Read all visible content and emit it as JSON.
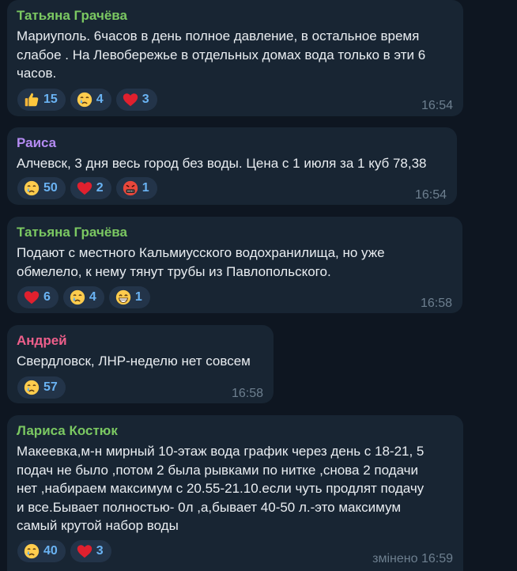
{
  "colors": {
    "background": "#0e1621",
    "bubble": "#182533",
    "reaction_chip": "#233449",
    "reaction_count": "#6ab3f3",
    "time": "#6d7f8f",
    "name_green": "#7bc862",
    "name_purple": "#b48bf2",
    "name_pink": "#ee5f8b"
  },
  "messages": [
    {
      "author": "Татьяна Грачёва",
      "author_color": "#7bc862",
      "lines": [
        "Мариуполь. 6часов в день полное давление, в остальное время",
        "слабое . На Левобережье в отдельных домах вода только в эти 6",
        "часов."
      ],
      "reactions": [
        {
          "icon": "thumbs-up-icon",
          "count": "15"
        },
        {
          "icon": "crying-face-icon",
          "count": "4"
        },
        {
          "icon": "red-heart-icon",
          "count": "3"
        }
      ],
      "time": "16:54"
    },
    {
      "author": "Раиса",
      "author_color": "#b48bf2",
      "lines": [
        "Алчевск, 3 дня весь город без воды. Цена с 1 июля за 1 куб 78,38"
      ],
      "reactions": [
        {
          "icon": "crying-face-icon",
          "count": "50"
        },
        {
          "icon": "red-heart-icon",
          "count": "2"
        },
        {
          "icon": "swearing-face-icon",
          "count": "1"
        }
      ],
      "time": "16:54"
    },
    {
      "author": "Татьяна Грачёва",
      "author_color": "#7bc862",
      "lines": [
        "Подают с местного  Кальмиусского водохранилища, но уже",
        "обмелело, к нему тянут трубы из Павлопольского."
      ],
      "reactions": [
        {
          "icon": "red-heart-icon",
          "count": "6"
        },
        {
          "icon": "crying-face-icon",
          "count": "4"
        },
        {
          "icon": "grinning-face-icon",
          "count": "1"
        }
      ],
      "time": "16:58"
    },
    {
      "author": "Андрей",
      "author_color": "#ee5f8b",
      "lines": [
        "Свердловск, ЛНР-неделю нет совсем"
      ],
      "reactions": [
        {
          "icon": "crying-face-icon",
          "count": "57"
        }
      ],
      "time": "16:58"
    },
    {
      "author": "Лариса Костюк",
      "author_color": "#7bc862",
      "lines": [
        "Макеевка,м-н мирный 10-этаж вода график через день с 18-21, 5",
        "подач не было ,потом 2 была рывками по нитке ,снова 2 подачи",
        "нет ,набираем максимум с 20.55-21.10.если чуть продлят подачу",
        "и все.Бывает полностью- 0л ,а,бывает 40-50  л.-это максимум",
        "самый крутой набор воды"
      ],
      "reactions": [
        {
          "icon": "crying-face-icon",
          "count": "40"
        },
        {
          "icon": "red-heart-icon",
          "count": "3"
        }
      ],
      "time": "змінено 16:59"
    }
  ]
}
